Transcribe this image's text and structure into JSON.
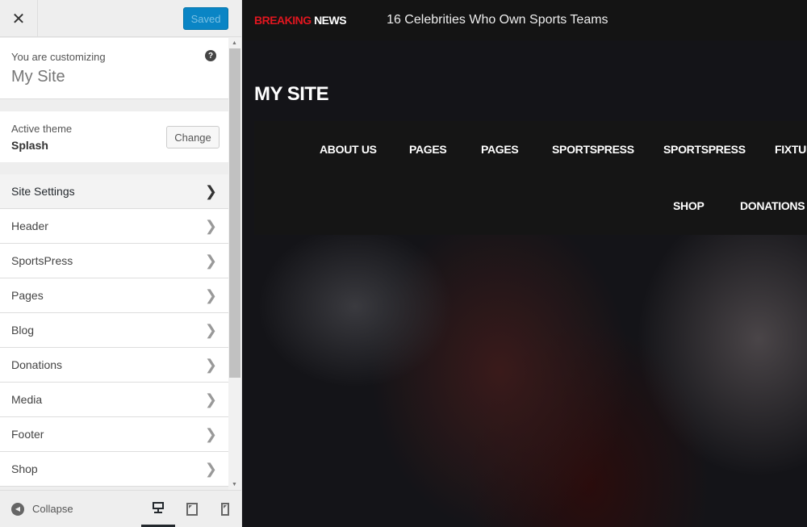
{
  "sidebar": {
    "close_label": "✕",
    "saved_label": "Saved",
    "customizing_label": "You are customizing",
    "site_name": "My Site",
    "help_icon": "?",
    "theme_label": "Active theme",
    "theme_name": "Splash",
    "change_label": "Change",
    "items": [
      {
        "label": "Site Settings"
      },
      {
        "label": "Header"
      },
      {
        "label": "SportsPress"
      },
      {
        "label": "Pages"
      },
      {
        "label": "Blog"
      },
      {
        "label": "Donations"
      },
      {
        "label": "Media"
      },
      {
        "label": "Footer"
      },
      {
        "label": "Shop"
      }
    ],
    "collapse_label": "Collapse"
  },
  "preview": {
    "breaking": "BREAKING",
    "news": "NEWS",
    "headline": "16 Celebrities Who Own Sports Teams",
    "site_title": "MY SITE",
    "nav": [
      "ABOUT US",
      "PAGES",
      "PAGES",
      "SPORTSPRESS",
      "SPORTSPRESS",
      "FIXTURES",
      "SHOP",
      "DONATIONS"
    ]
  },
  "colors": {
    "accent": "#0a85c5",
    "breaking_red": "#e0161f"
  }
}
